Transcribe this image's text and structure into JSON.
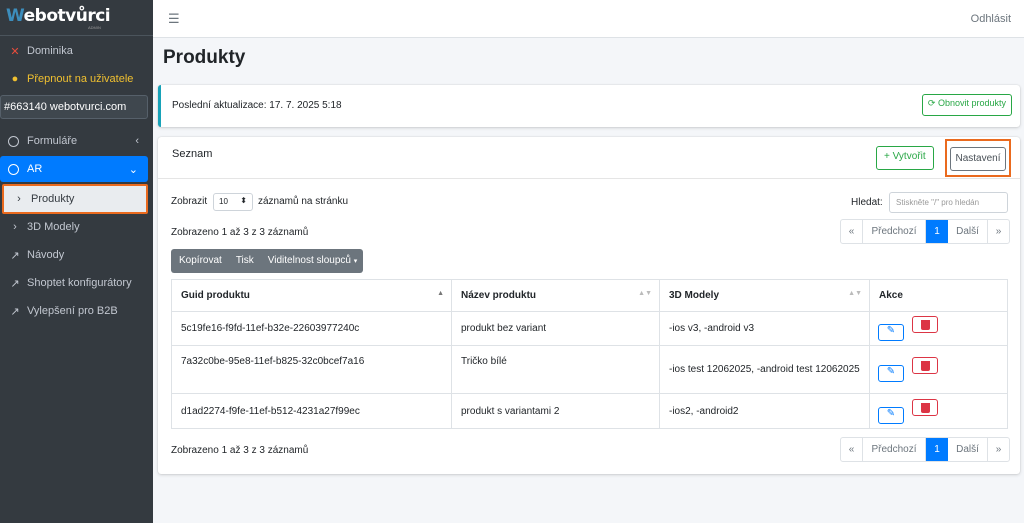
{
  "app": {
    "logo_w": "W",
    "logo_rest": "ebotvůrci",
    "logo_sub": "ADMIN",
    "logout": "Odhlásit"
  },
  "sidebar": {
    "user": "Dominika",
    "switch_user": "Přepnout na uživatele",
    "account": "#663140 webotvurci.com",
    "items": [
      {
        "label": "Formuláře"
      },
      {
        "label": "AR"
      },
      {
        "label": "Produkty"
      },
      {
        "label": "3D Modely"
      },
      {
        "label": "Návody"
      },
      {
        "label": "Shoptet konfigurátory"
      },
      {
        "label": "Vylepšení pro B2B"
      }
    ]
  },
  "page": {
    "title": "Produkty"
  },
  "update": {
    "text": "Poslední aktualizace: 17. 7. 2025 5:18",
    "refresh": "Obnovit produkty"
  },
  "list": {
    "title": "Seznam",
    "create": "Vytvořit",
    "settings": "Nastavení",
    "show": "Zobrazit",
    "per_page_value": "10",
    "per_page_suffix": "záznamů na stránku",
    "search_label": "Hledat:",
    "search_placeholder": "Stiskněte \"/\" pro hledán",
    "info": "Zobrazeno 1 až 3 z 3 záznamů",
    "toolbar": {
      "copy": "Kopírovat",
      "print": "Tisk",
      "columns": "Viditelnost sloupců"
    },
    "pager": {
      "first": "«",
      "prev": "Předchozí",
      "page": "1",
      "next": "Další",
      "last": "»"
    },
    "columns": [
      "Guid produktu",
      "Název produktu",
      "3D Modely",
      "Akce"
    ],
    "rows": [
      {
        "guid": "5c19fe16-f9fd-11ef-b32e-22603977240c",
        "name": "produkt bez variant",
        "models": "-ios v3, -android v3"
      },
      {
        "guid": "7a32c0be-95e8-11ef-b825-32c0bcef7a16",
        "name": "Tričko bílé",
        "models": "-ios test 12062025, -android test 12062025"
      },
      {
        "guid": "d1ad2274-f9fe-11ef-b512-4231a27f99ec",
        "name": "produkt s variantami 2",
        "models": "-ios2, -android2"
      }
    ]
  }
}
